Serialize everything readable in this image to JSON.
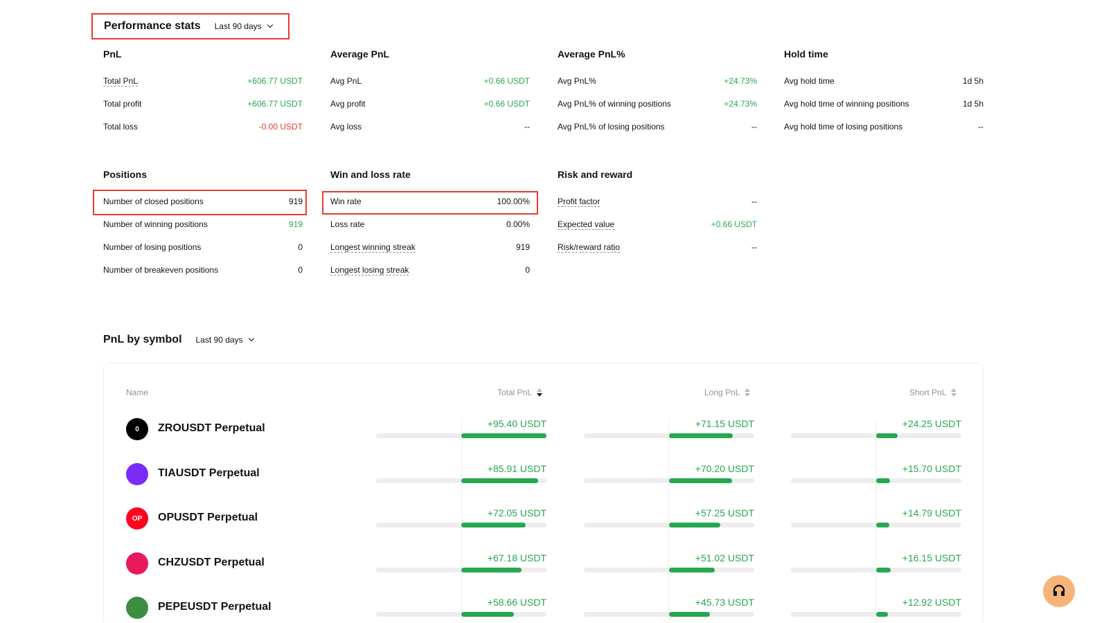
{
  "performance": {
    "title": "Performance stats",
    "range": "Last 90 days",
    "groups": {
      "pnl": {
        "title": "PnL",
        "rows": [
          {
            "label": "Total PnL",
            "value": "+606.77 USDT"
          },
          {
            "label": "Total profit",
            "value": "+606.77 USDT"
          },
          {
            "label": "Total loss",
            "value": "-0.00 USDT"
          }
        ]
      },
      "avg_pnl": {
        "title": "Average PnL",
        "rows": [
          {
            "label": "Avg PnL",
            "value": "+0.66 USDT"
          },
          {
            "label": "Avg profit",
            "value": "+0.66 USDT"
          },
          {
            "label": "Avg loss",
            "value": "--"
          }
        ]
      },
      "avg_pnl_pct": {
        "title": "Average PnL%",
        "rows": [
          {
            "label": "Avg PnL%",
            "value": "+24.73%"
          },
          {
            "label": "Avg PnL% of winning positions",
            "value": "+24.73%"
          },
          {
            "label": "Avg PnL% of losing positions",
            "value": "--"
          }
        ]
      },
      "hold_time": {
        "title": "Hold time",
        "rows": [
          {
            "label": "Avg hold time",
            "value": "1d 5h"
          },
          {
            "label": "Avg hold time of winning positions",
            "value": "1d 5h"
          },
          {
            "label": "Avg hold time of losing positions",
            "value": "--"
          }
        ]
      },
      "positions": {
        "title": "Positions",
        "rows": [
          {
            "label": "Number of closed positions",
            "value": "919"
          },
          {
            "label": "Number of winning positions",
            "value": "919"
          },
          {
            "label": "Number of losing positions",
            "value": "0"
          },
          {
            "label": "Number of breakeven positions",
            "value": "0"
          }
        ]
      },
      "win_loss": {
        "title": "Win and loss rate",
        "rows": [
          {
            "label": "Win rate",
            "value": "100.00%"
          },
          {
            "label": "Loss rate",
            "value": "0.00%"
          },
          {
            "label": "Longest winning streak",
            "value": "919"
          },
          {
            "label": "Longest losing streak",
            "value": "0"
          }
        ]
      },
      "risk_reward": {
        "title": "Risk and reward",
        "rows": [
          {
            "label": "Profit factor",
            "value": "--"
          },
          {
            "label": "Expected value",
            "value": "+0.66 USDT"
          },
          {
            "label": "Risk/reward ratio",
            "value": "--"
          }
        ]
      }
    }
  },
  "pnl_by_symbol": {
    "title": "PnL by symbol",
    "range": "Last 90 days",
    "columns": {
      "name": "Name",
      "total": "Total PnL",
      "long": "Long PnL",
      "short": "Short PnL"
    },
    "rows": [
      {
        "symbol": "ZROUSDT Perpetual",
        "icon": "zro-coin-icon",
        "icon_color": "#000000",
        "icon_text": "0",
        "total": "+95.40 USDT",
        "total_fill": 1.0,
        "long": "+71.15 USDT",
        "long_fill": 0.746,
        "short": "+24.25 USDT",
        "short_fill": 0.254
      },
      {
        "symbol": "TIAUSDT Perpetual",
        "icon": "tia-coin-icon",
        "icon_color": "#7b2bf9",
        "icon_text": "",
        "total": "+85.91 USDT",
        "total_fill": 0.9,
        "long": "+70.20 USDT",
        "long_fill": 0.736,
        "short": "+15.70 USDT",
        "short_fill": 0.165
      },
      {
        "symbol": "OPUSDT Perpetual",
        "icon": "op-coin-icon",
        "icon_color": "#ff0420",
        "icon_text": "OP",
        "total": "+72.05 USDT",
        "total_fill": 0.755,
        "long": "+57.25 USDT",
        "long_fill": 0.6,
        "short": "+14.79 USDT",
        "short_fill": 0.155
      },
      {
        "symbol": "CHZUSDT Perpetual",
        "icon": "chz-coin-icon",
        "icon_color": "#e7195a",
        "icon_text": "",
        "total": "+67.18 USDT",
        "total_fill": 0.704,
        "long": "+51.02 USDT",
        "long_fill": 0.535,
        "short": "+16.15 USDT",
        "short_fill": 0.169
      },
      {
        "symbol": "PEPEUSDT Perpetual",
        "icon": "pepe-coin-icon",
        "icon_color": "#3d8c40",
        "icon_text": "",
        "total": "+58.66 USDT",
        "total_fill": 0.615,
        "long": "+45.73 USDT",
        "long_fill": 0.479,
        "short": "+12.92 USDT",
        "short_fill": 0.135
      }
    ]
  },
  "colors": {
    "positive": "#25a750",
    "negative": "#e53b2f",
    "highlight": "#e53b2f",
    "support": "#f7b47a"
  }
}
